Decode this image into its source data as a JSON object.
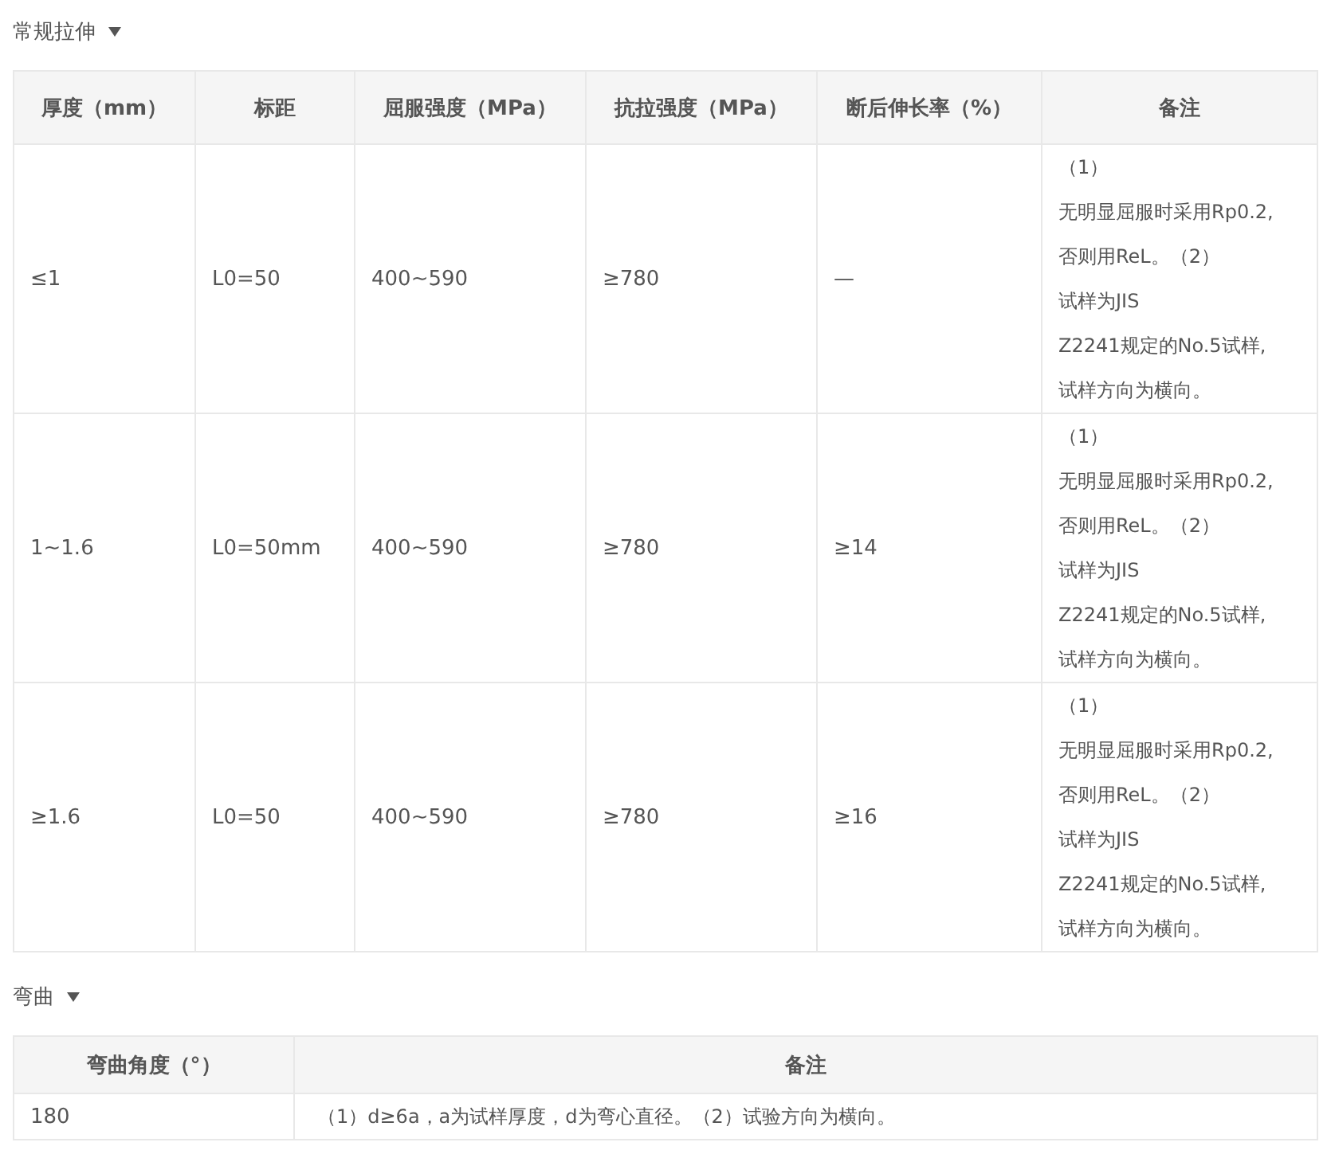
{
  "sections": [
    {
      "title": "常规拉伸",
      "expanded": true,
      "columns": [
        "厚度（mm）",
        "标距",
        "屈服强度（MPa）",
        "抗拉强度（MPa）",
        "断后伸长率（%）",
        "备注"
      ],
      "rows": [
        {
          "cells": [
            "≤1",
            "L0=50",
            "400~590",
            "≥780",
            "—"
          ],
          "note_lines": [
            "（1）",
            "无明显屈服时采用Rp0.2,",
            "否则用ReL。（2）",
            "试样为JIS",
            "Z2241规定的No.5试样,",
            "试样方向为横向。"
          ]
        },
        {
          "cells": [
            "1~1.6",
            "L0=50mm",
            "400~590",
            "≥780",
            "≥14"
          ],
          "note_lines": [
            "（1）",
            "无明显屈服时采用Rp0.2,",
            "否则用ReL。（2）",
            "试样为JIS",
            "Z2241规定的No.5试样,",
            "试样方向为横向。"
          ]
        },
        {
          "cells": [
            "≥1.6",
            "L0=50",
            "400~590",
            "≥780",
            "≥16"
          ],
          "note_lines": [
            "（1）",
            "无明显屈服时采用Rp0.2,",
            "否则用ReL。（2）",
            "试样为JIS",
            "Z2241规定的No.5试样,",
            "试样方向为横向。"
          ]
        }
      ]
    },
    {
      "title": "弯曲",
      "expanded": true,
      "columns": [
        "弯曲角度（°）",
        "备注"
      ],
      "rows": [
        {
          "cells": [
            "180"
          ],
          "note_lines": [
            "（1）d≥6a，a为试样厚度，d为弯心直径。（2）试验方向为横向。"
          ]
        }
      ]
    }
  ]
}
